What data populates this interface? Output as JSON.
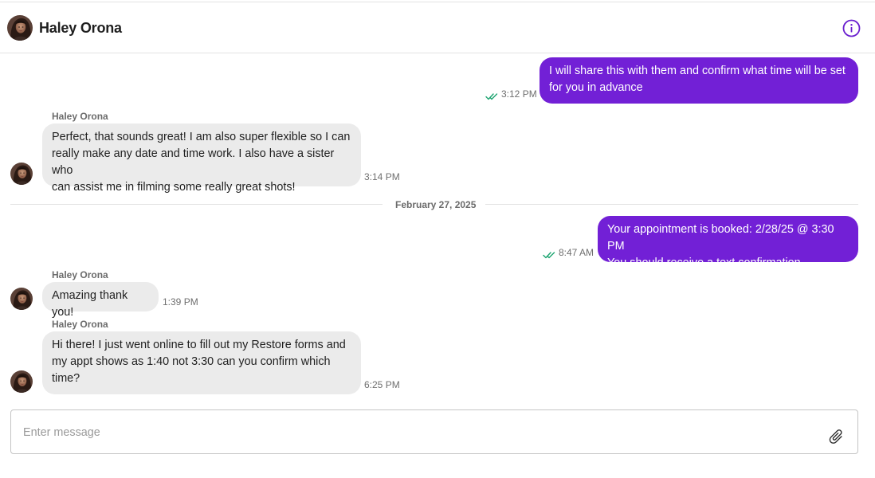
{
  "header": {
    "contact_name": "Haley Orona",
    "avatar_icon": "contact-photo-icon",
    "info_icon": "info-circle-icon"
  },
  "colors": {
    "outgoing_bubble": "#7220d6",
    "incoming_bubble": "#ebebeb",
    "read_check": "#1aa36f"
  },
  "messages": [
    {
      "direction": "outgoing",
      "lines": [
        "I will share this with them and confirm what time will be set",
        "for you in advance"
      ],
      "time": "3:12 PM",
      "status": "read"
    },
    {
      "direction": "incoming",
      "sender": "Haley Orona",
      "lines": [
        "Perfect, that sounds great! I am also super flexible so I can",
        "really make any date and time work. I also have a sister who",
        "can assist me in filming some really great shots!"
      ],
      "time": "3:14 PM"
    },
    {
      "direction": "outgoing",
      "lines": [
        "Your appointment is booked: 2/28/25 @ 3:30 PM",
        "You should receive a text confirmation"
      ],
      "time": "8:47 AM",
      "status": "read"
    },
    {
      "direction": "incoming",
      "sender": "Haley Orona",
      "lines": [
        "Amazing thank you!"
      ],
      "time": "1:39 PM"
    },
    {
      "direction": "incoming",
      "sender": "Haley Orona",
      "lines": [
        "Hi there! I just went online to fill out my Restore forms and",
        "my appt shows as 1:40 not 3:30 can you confirm which",
        "time?"
      ],
      "time": "6:25 PM"
    }
  ],
  "date_separator": "February 27, 2025",
  "composer": {
    "placeholder": "Enter message",
    "value": "",
    "attach_icon": "paperclip-icon"
  }
}
